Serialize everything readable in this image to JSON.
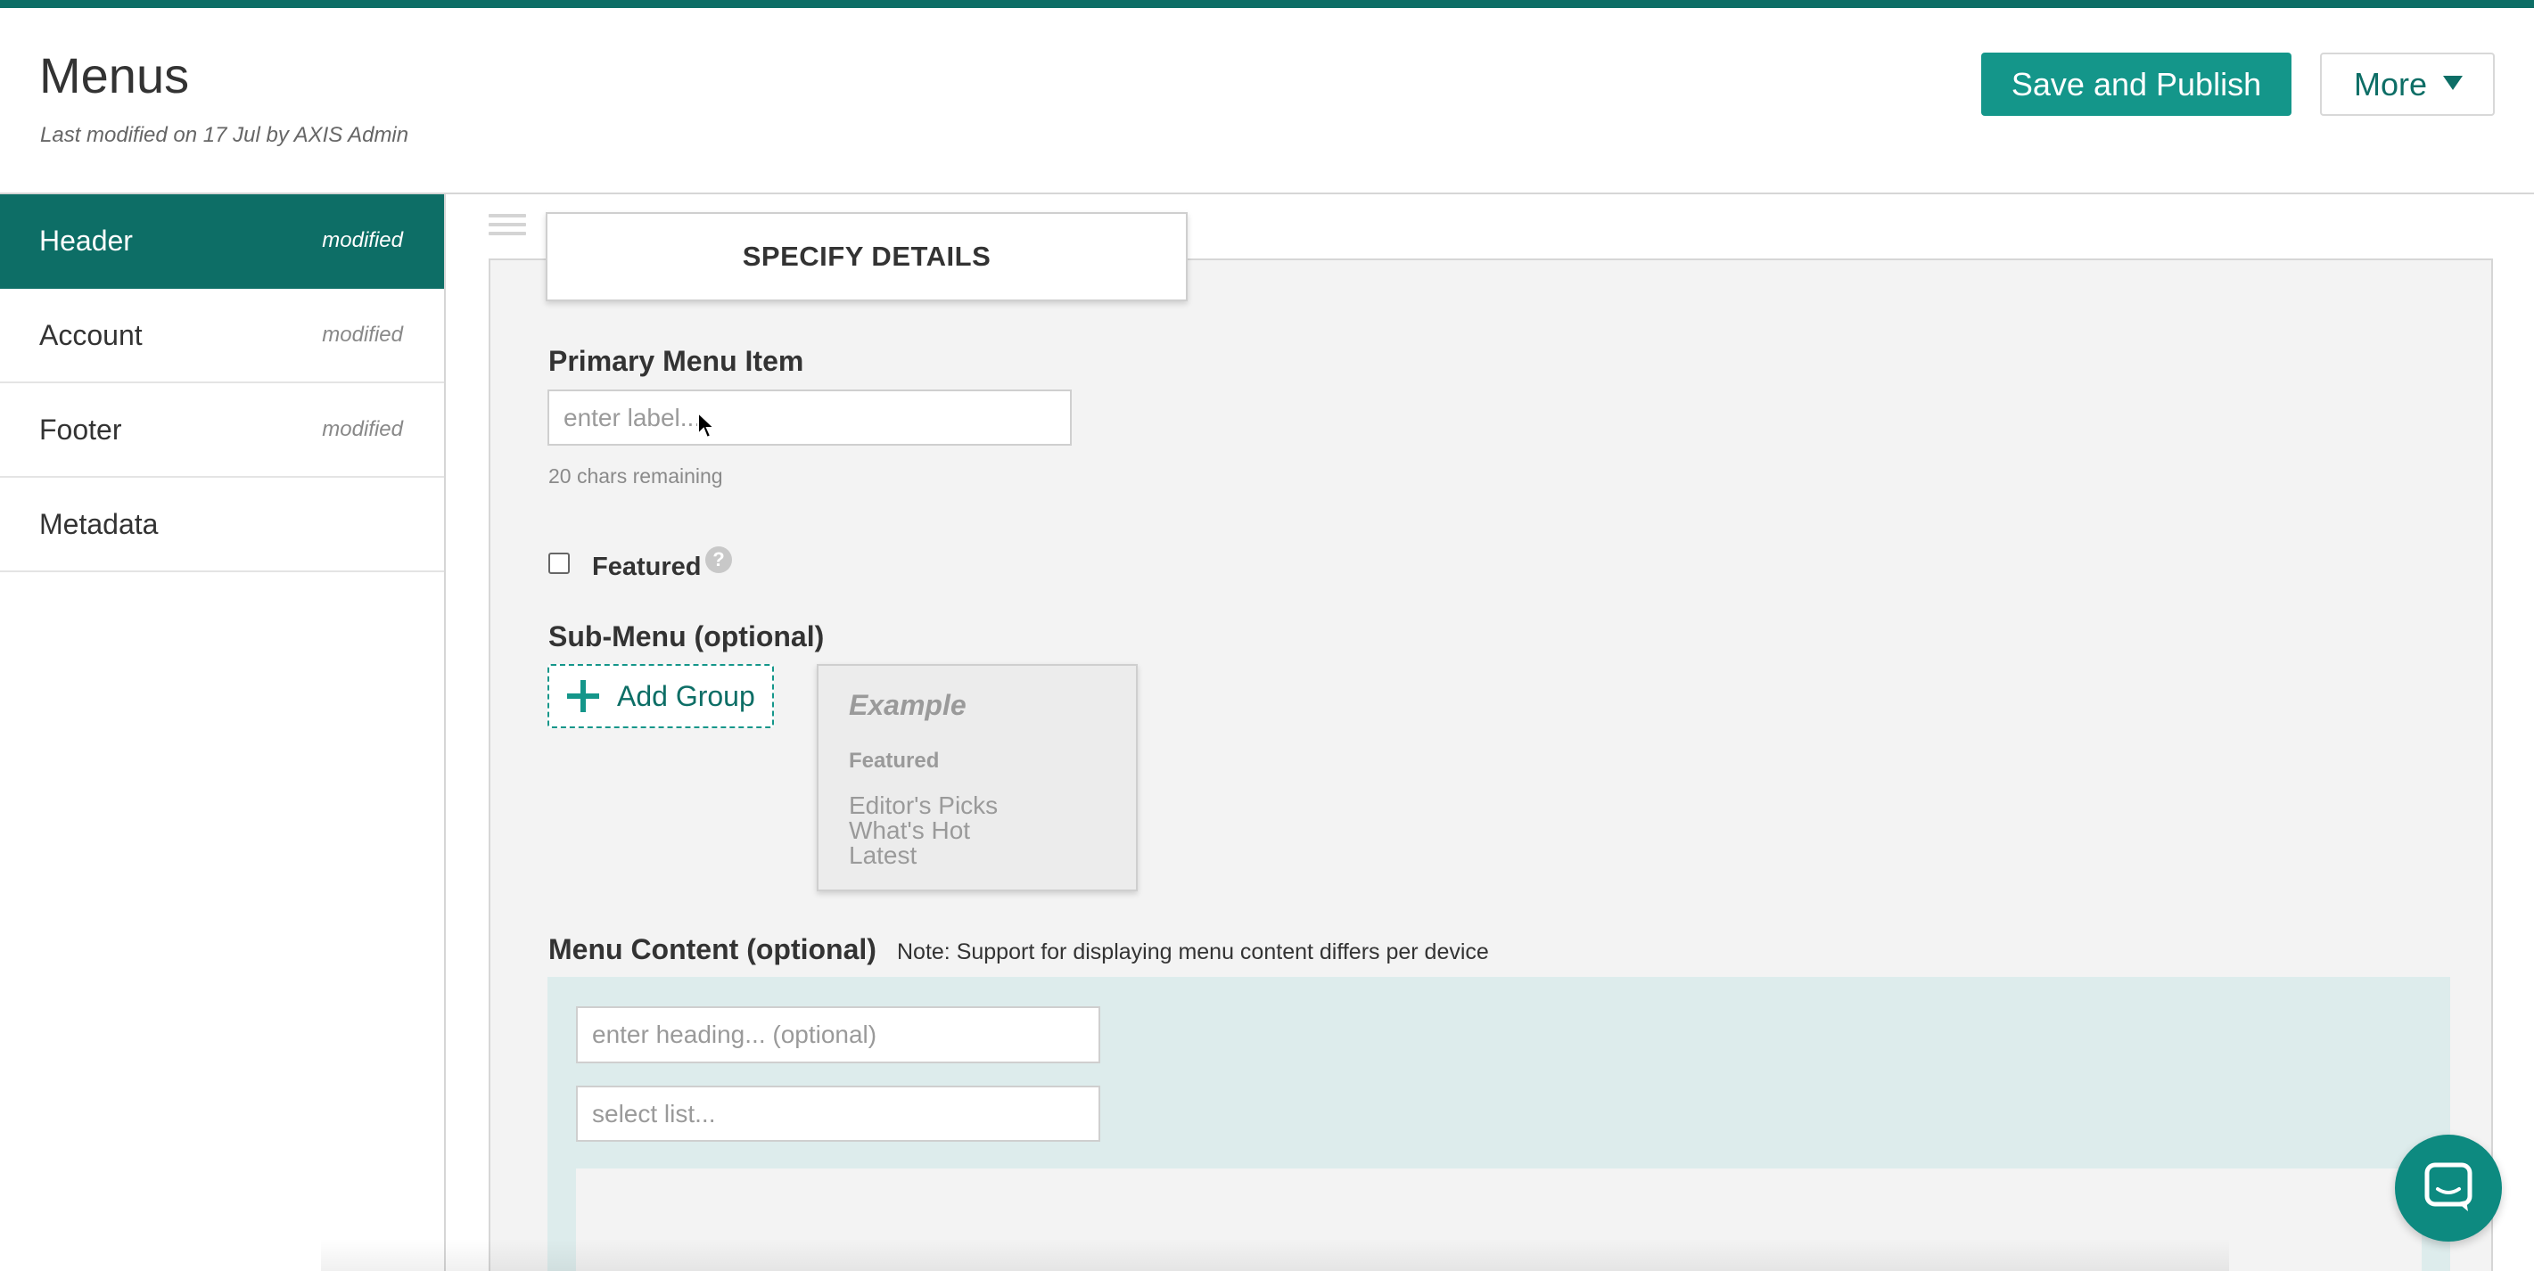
{
  "app": {
    "title": "Menus",
    "subtitle": "Last modified on 17 Jul by AXIS Admin",
    "accent_color": "#0d6e66",
    "button_color": "#14968a"
  },
  "toolbar": {
    "publish_label": "Save and Publish",
    "more_label": "More"
  },
  "sidebar": {
    "items": [
      {
        "label": "Header",
        "status": "modified",
        "active": true
      },
      {
        "label": "Account",
        "status": "modified",
        "active": false
      },
      {
        "label": "Footer",
        "status": "modified",
        "active": false
      },
      {
        "label": "Metadata",
        "status": "",
        "active": false
      }
    ]
  },
  "details": {
    "tab_label": "SPECIFY DETAILS",
    "primary_label": "Primary Menu Item",
    "primary_placeholder": "enter label...",
    "chars_remaining": "20 chars remaining",
    "featured_label": "Featured",
    "featured_checked": false,
    "help_icon": "?",
    "submenu_label": "Sub-Menu (optional)",
    "add_group_label": "Add Group",
    "example": {
      "title": "Example",
      "heading": "Featured",
      "items": [
        "Editor's Picks",
        "What's Hot",
        "Latest"
      ]
    },
    "content_label": "Menu Content (optional)",
    "content_note": "Note: Support for displaying menu content differs per device",
    "heading_placeholder": "enter heading... (optional)",
    "list_placeholder": "select list..."
  },
  "icons": {
    "drag": "drag-handle-icon",
    "plus": "plus-icon",
    "help": "help-icon",
    "chat": "chat-icon",
    "cursor": "mouse-cursor-icon"
  }
}
